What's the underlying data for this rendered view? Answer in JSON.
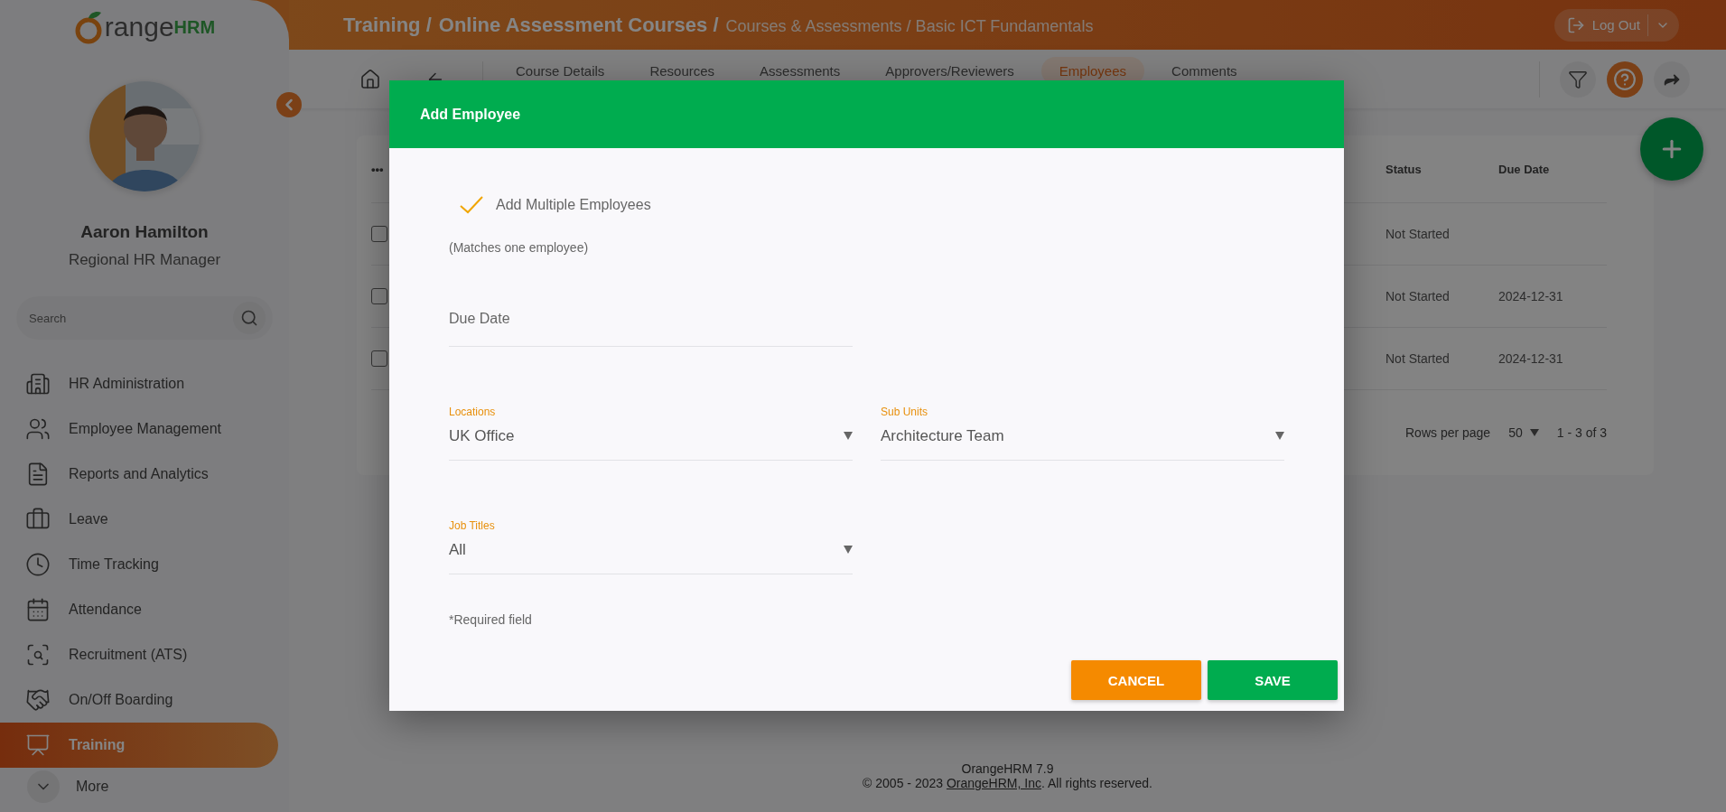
{
  "sidebar": {
    "logo": {
      "wordmark": "range",
      "suffix": "HRM"
    },
    "user": {
      "name": "Aaron Hamilton",
      "role": "Regional HR Manager"
    },
    "search": {
      "placeholder": "Search"
    },
    "nav": [
      {
        "label": "HR Administration",
        "selected": false
      },
      {
        "label": "Employee Management",
        "selected": false
      },
      {
        "label": "Reports and Analytics",
        "selected": false
      },
      {
        "label": "Leave",
        "selected": false
      },
      {
        "label": "Time Tracking",
        "selected": false
      },
      {
        "label": "Attendance",
        "selected": false
      },
      {
        "label": "Recruitment (ATS)",
        "selected": false
      },
      {
        "label": "On/Off Boarding",
        "selected": false
      },
      {
        "label": "Training",
        "selected": true
      }
    ],
    "more": {
      "label": "More"
    }
  },
  "topbar": {
    "breadcrumb": [
      {
        "text": "Training /",
        "kind": "main"
      },
      {
        "text": "Online Assessment Courses /",
        "kind": "main"
      },
      {
        "text": "Courses & Assessments / Basic ICT Fundamentals",
        "kind": "sub"
      }
    ],
    "logout": "Log Out"
  },
  "tabs": [
    {
      "label": "Course Details",
      "selected": false
    },
    {
      "label": "Resources",
      "selected": false
    },
    {
      "label": "Assessments",
      "selected": false
    },
    {
      "label": "Approvers/Reviewers",
      "selected": false
    },
    {
      "label": "Employees",
      "selected": true
    },
    {
      "label": "Comments",
      "selected": false
    }
  ],
  "table": {
    "columns": [
      "•••",
      "Status",
      "Due Date"
    ],
    "rows": [
      {
        "checked": false,
        "status": "Not Started"
      },
      {
        "checked": false,
        "status": "Not Started",
        "due_date": "2024-12-31"
      },
      {
        "checked": false,
        "status": "Not Started",
        "due_date": "2024-12-31"
      }
    ],
    "pagination": {
      "rows_label": "Rows per page",
      "rows_value": "50",
      "range": "1 - 3 of 3"
    }
  },
  "dialog": {
    "title": "Add Employee",
    "multiple": {
      "label": "Add Multiple Employees",
      "checked": true
    },
    "note": "(Matches one employee)",
    "due_date": {
      "placeholder": "Due Date"
    },
    "fields": [
      {
        "label": "Locations",
        "value": "UK Office"
      },
      {
        "label": "Sub Units",
        "value": "Architecture Team"
      },
      {
        "label": "Job Titles",
        "value": "All"
      }
    ],
    "required": "*Required field",
    "buttons": [
      {
        "label": "CANCEL",
        "kind": "cancel"
      },
      {
        "label": "SAVE",
        "kind": "save"
      }
    ]
  },
  "footer": {
    "version": "OrangeHRM 7.9",
    "copyright": {
      "before": "© 2005 - 2023 ",
      "link": "OrangeHRM, Inc",
      "after": ". All rights reserved."
    }
  }
}
